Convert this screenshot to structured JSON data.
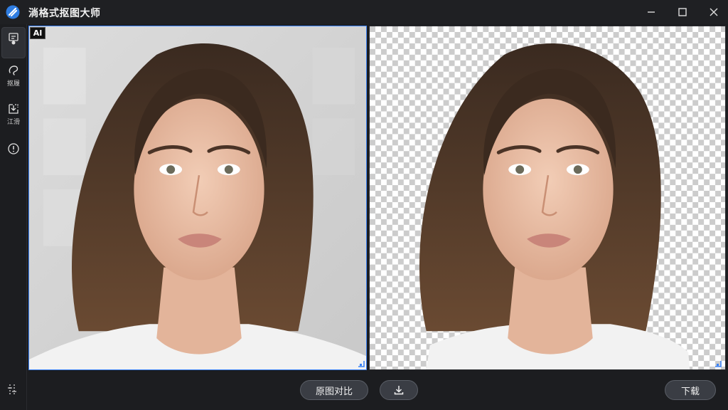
{
  "app": {
    "title": "淌格式抠图大师",
    "logo_icon": "app-logo-icon",
    "accent": "#3b82f6"
  },
  "window_controls": {
    "minimize_icon": "minimize-icon",
    "maximize_icon": "maximize-icon",
    "close_icon": "close-icon"
  },
  "sidebar": {
    "items": [
      {
        "icon": "cutout-tool-icon",
        "label": "",
        "active": true
      },
      {
        "icon": "lasso-tool-icon",
        "label": "抠履"
      },
      {
        "icon": "import-tool-icon",
        "label": "江滑"
      },
      {
        "icon": "info-icon",
        "label": ""
      }
    ],
    "bottom_icon": "adjust-icon"
  },
  "canvas": {
    "ai_badge": "AI",
    "left_panel": "original-image",
    "right_panel": "cutout-result-image"
  },
  "bottom": {
    "compare_label": "原图对比",
    "download_icon": "download-icon",
    "download_label": "下载"
  }
}
